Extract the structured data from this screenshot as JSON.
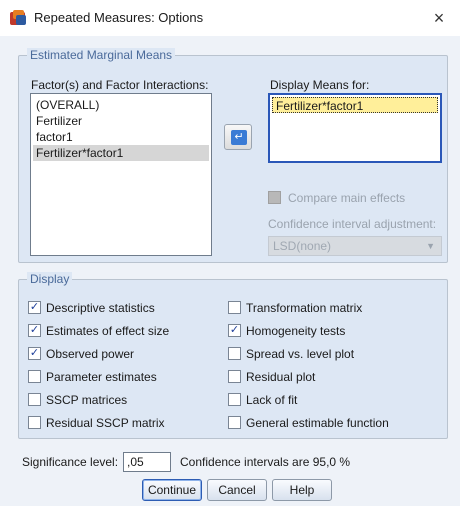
{
  "window": {
    "title": "Repeated Measures: Options",
    "close_glyph": "×"
  },
  "emm": {
    "legend": "Estimated Marginal Means",
    "factors_label": "Factor(s) and Factor Interactions:",
    "factors": [
      "(OVERALL)",
      "Fertilizer",
      "factor1",
      "Fertilizer*factor1"
    ],
    "selected_factor": "Fertilizer*factor1",
    "means_label": "Display Means for:",
    "means_items": [
      "Fertilizer*factor1"
    ],
    "compare_label": "Compare main effects",
    "ci_adjust_label": "Confidence interval adjustment:",
    "ci_adjust_value": "LSD(none)"
  },
  "display": {
    "legend": "Display",
    "left": [
      {
        "label": "Descriptive statistics",
        "checked": true
      },
      {
        "label": "Estimates of effect size",
        "checked": true
      },
      {
        "label": "Observed power",
        "checked": true
      },
      {
        "label": "Parameter estimates",
        "checked": false
      },
      {
        "label": "SSCP matrices",
        "checked": false
      },
      {
        "label": "Residual SSCP matrix",
        "checked": false
      }
    ],
    "right": [
      {
        "label": "Transformation matrix",
        "checked": false
      },
      {
        "label": "Homogeneity tests",
        "checked": true
      },
      {
        "label": "Spread vs. level plot",
        "checked": false
      },
      {
        "label": "Residual plot",
        "checked": false
      },
      {
        "label": "Lack of fit",
        "checked": false
      },
      {
        "label": "General estimable function",
        "checked": false
      }
    ]
  },
  "significance": {
    "label": "Significance level:",
    "value": ",05",
    "ci_text": "Confidence intervals are 95,0 %"
  },
  "buttons": {
    "continue": "Continue",
    "cancel": "Cancel",
    "help": "Help"
  },
  "checkmark": "✓",
  "colors": {
    "selection_highlight": "#ffef9a",
    "legend_text": "#4a6a9a",
    "group_bg": "#dde7f4"
  }
}
